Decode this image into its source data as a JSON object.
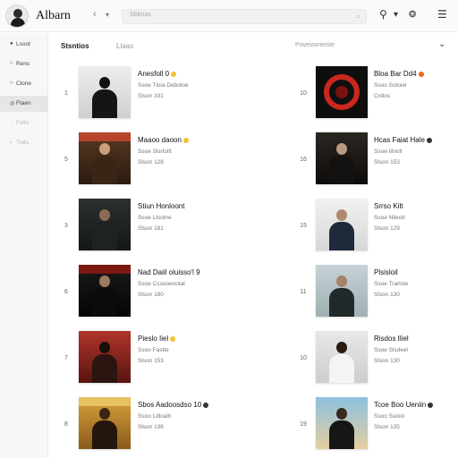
{
  "app": {
    "title": "Albarn"
  },
  "search": {
    "placeholder": "Sbbnas"
  },
  "sidebar": {
    "items": [
      {
        "label": "Lsoot",
        "active": false,
        "dim": false
      },
      {
        "label": "Rens",
        "active": false,
        "dim": false
      },
      {
        "label": "Clone",
        "active": false,
        "dim": false
      },
      {
        "label": "Ftaen",
        "active": true,
        "dim": false
      },
      {
        "label": "Felto",
        "active": false,
        "dim": true
      },
      {
        "label": "Tlats",
        "active": false,
        "dim": true
      }
    ]
  },
  "tabs": [
    {
      "label": "Stsntios",
      "active": true
    },
    {
      "label": "Llaas",
      "active": false
    }
  ],
  "sort_label": "Poveioorieiste",
  "colors": {
    "badge_yellow": "#f2c230",
    "badge_orange": "#e86a1c",
    "badge_dark": "#333333"
  },
  "albums_left": [
    {
      "rank": "1",
      "title": "Anesfoll 0",
      "badge": "yellow",
      "line1": "Ssoe Tloia Deboloe",
      "line2": "Slson 331",
      "cover": "dark-dj"
    },
    {
      "rank": "5",
      "title": "Maaoo daoon",
      "badge": "yellow",
      "line1": "Ssoe Slsrloilt",
      "line2": "Slson 128",
      "cover": "sepia"
    },
    {
      "rank": "3",
      "title": "Stiun Honloont",
      "badge": "",
      "line1": "Ssoe Ltsolne",
      "line2": "Slson 181",
      "cover": "dark-man"
    },
    {
      "rank": "6",
      "title": "Nad Daiil oluisso'l 9",
      "badge": "",
      "line1": "Ssoe Ccsooenotal",
      "line2": "Slson 180",
      "cover": "dark-suit"
    },
    {
      "rank": "7",
      "title": "Pieslo Iiel",
      "badge": "yellow",
      "line1": "Ssoo Fastte",
      "line2": "Slson 153",
      "cover": "red-woman"
    },
    {
      "rank": "8",
      "title": "Sbos Aadoosdso 10",
      "badge": "dark",
      "line1": "Ssoo Ldloalh",
      "line2": "Slson 136",
      "cover": "gold"
    }
  ],
  "albums_right": [
    {
      "rank": "10",
      "title": "Bloa Bar Dd4",
      "badge": "orange",
      "line1": "Ssoo Sotoiel",
      "line2": "Cnllos",
      "cover": "red-disc"
    },
    {
      "rank": "16",
      "title": "Hcas Faiat Hale",
      "badge": "dark",
      "line1": "Ssoe Iilnoll",
      "line2": "Slson 153",
      "cover": "dark-long"
    },
    {
      "rank": "15",
      "title": "Srrso Kilt",
      "badge": "",
      "line1": "Ssoe Nlleoti",
      "line2": "Slson 129",
      "cover": "light-man"
    },
    {
      "rank": "11",
      "title": "Plsisloil",
      "badge": "",
      "line1": "Ssoe Trartsle",
      "line2": "Slson 130",
      "cover": "sky-man"
    },
    {
      "rank": "10",
      "title": "Risdos Iliel",
      "badge": "",
      "line1": "Ssoe Slsdeel",
      "line2": "Slson 130",
      "cover": "light-tie"
    },
    {
      "rank": "19",
      "title": "Tcoe Boo Ueniin",
      "badge": "dark",
      "line1": "Ssoo Ssioio",
      "line2": "Slson 135",
      "cover": "desert"
    }
  ]
}
